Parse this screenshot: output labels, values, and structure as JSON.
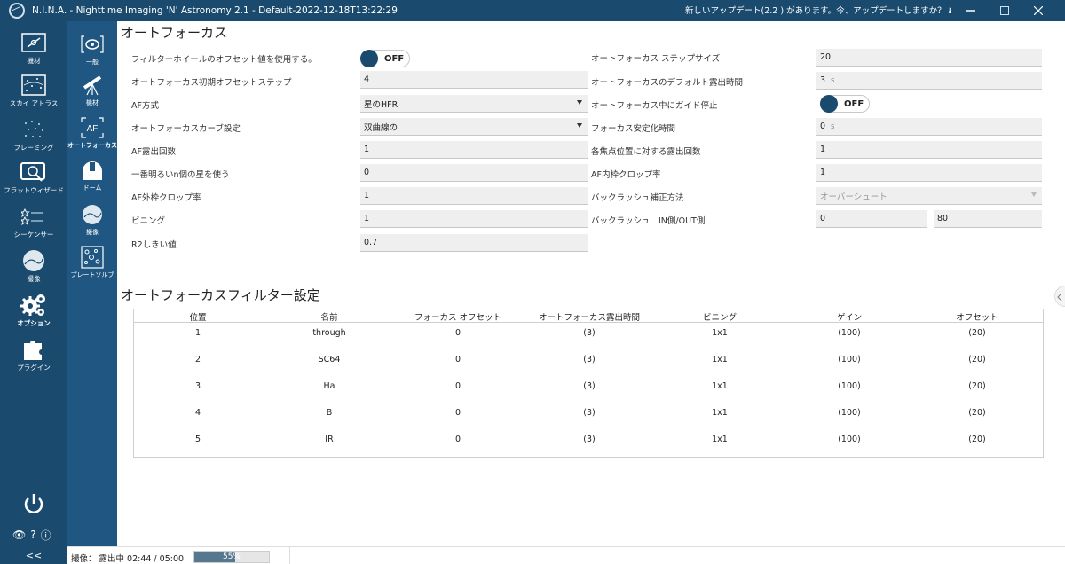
{
  "window": {
    "title": "N.I.N.A. - Nighttime Imaging 'N' Astronomy 2.1  -  Default-2022-12-18T13:22:29",
    "update_notice": "新しいアップデート(2.2 ) があります。今、アップデートしますか？"
  },
  "nav": {
    "items": [
      {
        "label": "機材",
        "icon": "telescope-panel-icon"
      },
      {
        "label": "スカイ アトラス",
        "icon": "sky-map-icon"
      },
      {
        "label": "フレーミング",
        "icon": "stars-framing-icon"
      },
      {
        "label": "フラットウィザード",
        "icon": "flat-panel-icon"
      },
      {
        "label": "シーケンサー",
        "icon": "sequence-list-icon"
      },
      {
        "label": "撮像",
        "icon": "image-circle-icon"
      },
      {
        "label": "オプション",
        "icon": "gears-icon"
      },
      {
        "label": "プラグイン",
        "icon": "puzzle-icon"
      }
    ],
    "collapse": "<<"
  },
  "subnav": {
    "items": [
      {
        "label": "一般",
        "icon": "general-icon"
      },
      {
        "label": "機材",
        "icon": "telescope-icon"
      },
      {
        "label": "オートフォーカス",
        "icon": "af-icon",
        "icon_text": "AF"
      },
      {
        "label": "ドーム",
        "icon": "dome-icon"
      },
      {
        "label": "撮像",
        "icon": "imaging-icon"
      },
      {
        "label": "プレートソルブ",
        "icon": "platesolve-icon"
      }
    ]
  },
  "autofocus": {
    "title": "オートフォーカス",
    "left": {
      "use_filter_offsets_label": "フィルターホイールのオフセット値を使用する。",
      "use_filter_offsets": "OFF",
      "initial_offset_steps_label": "オートフォーカス初期オフセットステップ",
      "initial_offset_steps": "4",
      "af_method_label": "AF方式",
      "af_method": "星のHFR",
      "curve_fitting_label": "オートフォーカスカーブ設定",
      "curve_fitting": "双曲線の",
      "af_exposures_label": "AF露出回数",
      "af_exposures": "1",
      "brightest_stars_label": "一番明るいn個の星を使う",
      "brightest_stars": "0",
      "outer_crop_label": "AF外枠クロップ率",
      "outer_crop": "1",
      "binning_label": "ビニング",
      "binning": "1",
      "r2_label": "R2しきい値",
      "r2": "0.7"
    },
    "right": {
      "step_size_label": "オートフォーカス ステップサイズ",
      "step_size": "20",
      "default_exposure_label": "オートフォーカスのデフォルト露出時間",
      "default_exposure": "3",
      "default_exposure_unit": "s",
      "disable_guiding_label": "オートフォーカス中にガイド停止",
      "disable_guiding": "OFF",
      "settle_time_label": "フォーカス安定化時間",
      "settle_time": "0",
      "settle_time_unit": "s",
      "exposures_per_point_label": "各焦点位置に対する露出回数",
      "exposures_per_point": "1",
      "inner_crop_label": "AF内枠クロップ率",
      "inner_crop": "1",
      "backlash_method_label": "バックラッシュ補正方法",
      "backlash_method": "オーバーシュート",
      "backlash_label": "バックラッシュ　IN側/OUT側",
      "backlash_in": "0",
      "backlash_out": "80"
    }
  },
  "filter_settings": {
    "title": "オートフォーカスフィルター設定",
    "columns": [
      "位置",
      "名前",
      "フォーカス オフセット",
      "オートフォーカス露出時間",
      "ビニング",
      "ゲイン",
      "オフセット"
    ],
    "rows": [
      [
        "1",
        "through",
        "0",
        "(3)",
        "1x1",
        "(100)",
        "(20)"
      ],
      [
        "2",
        "SC64",
        "0",
        "(3)",
        "1x1",
        "(100)",
        "(20)"
      ],
      [
        "3",
        "Ha",
        "0",
        "(3)",
        "1x1",
        "(100)",
        "(20)"
      ],
      [
        "4",
        "B",
        "0",
        "(3)",
        "1x1",
        "(100)",
        "(20)"
      ],
      [
        "5",
        "IR",
        "0",
        "(3)",
        "1x1",
        "(100)",
        "(20)"
      ]
    ]
  },
  "status": {
    "text": "撮像：  露出中 02:44 / 05:00",
    "progress_label": "55%",
    "progress": 0.55
  },
  "colors": {
    "nav_bg": "#1a4a6e",
    "subnav_bg": "#1f5782",
    "toggle_knob": "#1a4a6e"
  }
}
